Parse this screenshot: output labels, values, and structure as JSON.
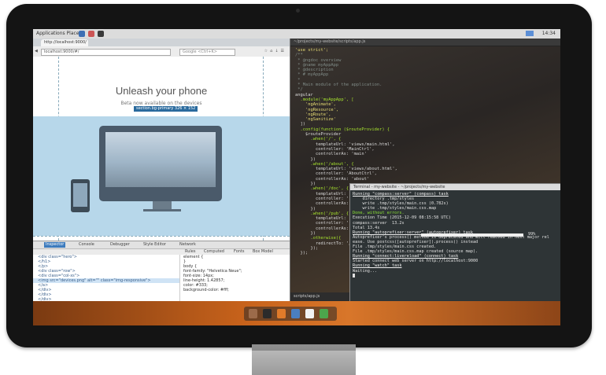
{
  "os": {
    "menu_label": "Applications Places",
    "clock": "14:34"
  },
  "browser": {
    "tab_title": "http://localhost:9000/",
    "url": "localhost:9000/#/",
    "search_placeholder": "Google <Ctrl+K>",
    "page": {
      "headline": "Unleash your phone",
      "subline": "Beta now available on the devices",
      "tooltip": "section.bg-primary 326 × 152"
    },
    "devtools": {
      "tabs": [
        "Inspector",
        "Console",
        "Debugger",
        "Style Editor",
        "Network"
      ],
      "markup_lines": [
        "<div class=\"hero\">",
        "  </h1>",
        "  </p>",
        "<div class=\"row\">",
        "  <div class=\"col-xs\">",
        "    <img src=\"devices.png\" alt=\"\" class=\"img-responsive\">",
        "    </a>",
        "  </div>",
        "</div>",
        "</div>",
        "</section>"
      ],
      "rule_tabs": [
        "Rules",
        "Computed",
        "Fonts",
        "Box Model"
      ],
      "rules": [
        "element {",
        "}",
        "body {",
        "  font-family: \"Helvetica Neue\";",
        "  font-size: 14px;",
        "  line-height: 1.42857;",
        "  color: #333;",
        "  background-color: #fff;"
      ]
    }
  },
  "editor": {
    "title": "~/projects/my-website/scripts/app.js",
    "status": "scripts/app.js",
    "code": [
      "'use strict';",
      "",
      "/**",
      " * @ngdoc overview",
      " * @name myAppApp",
      " * @description",
      " * # myAppApp",
      " *",
      " * Main module of the application.",
      " */",
      "angular",
      "  .module('myAppApp', [",
      "    'ngAnimate',",
      "    'ngResource',",
      "    'ngRoute',",
      "    'ngSanitize'",
      "  ])",
      "  .config(function ($routeProvider) {",
      "    $routeProvider",
      "      .when('/', {",
      "        templateUrl: 'views/main.html',",
      "        controller: 'MainCtrl',",
      "        controllerAs: 'main'",
      "      })",
      "      .when('/about', {",
      "        templateUrl: 'views/about.html',",
      "        controller: 'AboutCtrl',",
      "        controllerAs: 'about'",
      "      })",
      "      .when('/doc', {",
      "        templateUrl: '",
      "        controller: '",
      "        controllerAs: '",
      "      })",
      "      .when('/pub', {",
      "        templateUrl: '",
      "        controller: '",
      "        controllerAs: '",
      "      })",
      "      .otherwise({",
      "        redirectTo: '/'",
      "      });",
      "  });"
    ]
  },
  "terminal": {
    "title": "Terminal - my-website - ~/projects/my-website",
    "lines": [
      "Running \"compass:server\" (compass) task",
      "    directory .tmp/styles",
      "    write .tmp/styles/main.css (0.782s)",
      "    write .tmp/styles/main.css.map",
      "",
      "Done, without errors.",
      "",
      "",
      "Execution Time (2015-12-09 08:15:58 UTC)",
      "compass:server  13.2s",
      "Total 13.4s",
      "",
      "Running \"autoprefixer:server\" (autoprefixer) task",
      "Autoprefixer's process() method is deprecated and will removed in next major rel",
      "ease. Use postcss([autoprefixer]).process() instead",
      "File .tmp/styles/main.css created.",
      "File .tmp/styles/main.css.map created (source map).",
      "",
      "Running \"connect:livereload\" (connect) task",
      "Started connect web server on http://localhost:9000",
      "",
      "Running \"watch\" task",
      "Waiting..."
    ],
    "progress_percent": 99,
    "progress_label": "99%"
  },
  "dock": {
    "items": [
      "show-desktop-icon",
      "terminal-icon",
      "firefox-icon",
      "files-icon",
      "gedit-icon",
      "libreoffice-icon"
    ]
  }
}
